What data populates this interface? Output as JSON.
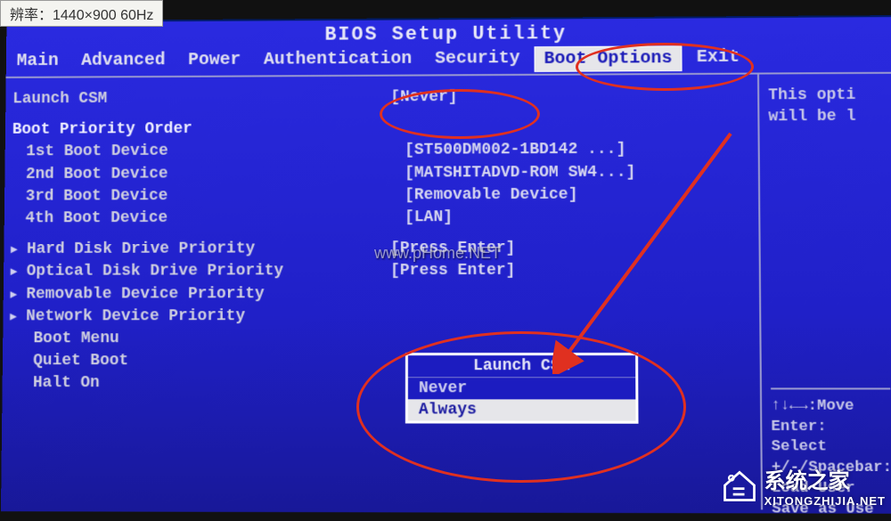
{
  "sticker": "辨率：1440×900 60Hz",
  "title": "BIOS Setup Utility",
  "menu": [
    {
      "label": "Main"
    },
    {
      "label": "Advanced"
    },
    {
      "label": "Power"
    },
    {
      "label": "Authentication"
    },
    {
      "label": "Security"
    },
    {
      "label": "Boot Options",
      "selected": true
    },
    {
      "label": "Exit"
    }
  ],
  "launch_csm": {
    "label": "Launch CSM",
    "value": "[Never]"
  },
  "boot_order_head": "Boot Priority Order",
  "boot_devices": [
    {
      "label": "1st Boot Device",
      "value": "[ST500DM002-1BD142  ...]"
    },
    {
      "label": "2nd Boot Device",
      "value": "[MATSHITADVD-ROM SW4...]"
    },
    {
      "label": "3rd Boot Device",
      "value": "[Removable Device]"
    },
    {
      "label": "4th Boot Device",
      "value": "[LAN]"
    }
  ],
  "submenus": [
    {
      "label": "Hard Disk Drive Priority",
      "value": "[Press Enter]"
    },
    {
      "label": "Optical Disk Drive Priority",
      "value": "[Press Enter]"
    },
    {
      "label": "Removable Device Priority",
      "value": ""
    },
    {
      "label": "Network Device Priority",
      "value": ""
    }
  ],
  "misc": [
    {
      "label": "Boot Menu",
      "value": ""
    },
    {
      "label": "Quiet Boot",
      "value": "["
    },
    {
      "label": "Halt On",
      "value": ""
    }
  ],
  "popup": {
    "title": "Launch CSM",
    "options": [
      "Never",
      "Always"
    ],
    "highlight": "Always"
  },
  "help_text": [
    "This opti",
    "will be l"
  ],
  "keyhelp": [
    "↑↓←→:Move",
    "Enter: Select",
    "+/-/Spacebar:",
    "   Load User",
    "   Save as Use"
  ],
  "watermarks": {
    "phome": "www.pHome.NET",
    "xt_name": "系统之家",
    "xt_url": "XITONGZHIJIA.NET"
  }
}
